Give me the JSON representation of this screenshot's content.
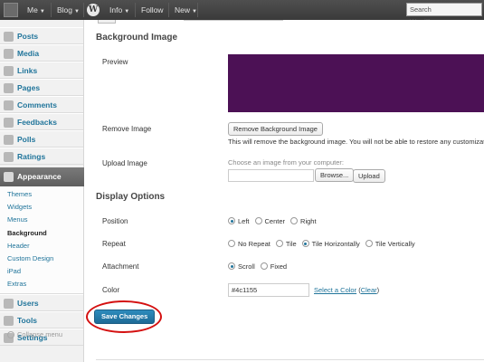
{
  "adminbar": {
    "me": "Me",
    "blog": "Blog",
    "wp_logo": "W",
    "info": "Info",
    "follow": "Follow",
    "new": "New",
    "search_placeholder": "Search WordPress.com"
  },
  "sidebar": {
    "items_top": [
      {
        "label": "Posts",
        "icon": "pushpin-icon"
      },
      {
        "label": "Media",
        "icon": "media-icon"
      },
      {
        "label": "Links",
        "icon": "links-icon"
      },
      {
        "label": "Pages",
        "icon": "pages-icon"
      },
      {
        "label": "Comments",
        "icon": "comments-icon"
      },
      {
        "label": "Feedbacks",
        "icon": "feedbacks-icon"
      },
      {
        "label": "Polls",
        "icon": "polls-icon"
      },
      {
        "label": "Ratings",
        "icon": "ratings-icon"
      }
    ],
    "appearance": "Appearance",
    "submenu": [
      "Themes",
      "Widgets",
      "Menus",
      "Background",
      "Header",
      "Custom Design",
      "iPad",
      "Extras"
    ],
    "current_submenu": "Background",
    "items_bottom": [
      {
        "label": "Users",
        "icon": "users-icon"
      },
      {
        "label": "Tools",
        "icon": "tools-icon"
      },
      {
        "label": "Settings",
        "icon": "settings-icon"
      }
    ],
    "collapse": "Collapse menu"
  },
  "main": {
    "background_image_heading": "Background Image",
    "preview_label": "Preview",
    "preview_color": "#4c1155",
    "remove_label": "Remove Image",
    "remove_button": "Remove Background Image",
    "remove_note": "This will remove the background image. You will not be able to restore any customizati",
    "upload_label": "Upload Image",
    "upload_hint": "Choose an image from your computer:",
    "browse_button": "Browse...",
    "upload_button": "Upload",
    "display_heading": "Display Options",
    "position_label": "Position",
    "position_options": [
      "Left",
      "Center",
      "Right"
    ],
    "position_selected": "Left",
    "repeat_label": "Repeat",
    "repeat_options": [
      "No Repeat",
      "Tile",
      "Tile Horizontally",
      "Tile Vertically"
    ],
    "repeat_selected": "Tile Horizontally",
    "attachment_label": "Attachment",
    "attachment_options": [
      "Scroll",
      "Fixed"
    ],
    "attachment_selected": "Scroll",
    "color_label": "Color",
    "color_value": "#4c1155",
    "select_color": "Select a Color",
    "clear": "Clear",
    "save_button": "Save Changes"
  }
}
